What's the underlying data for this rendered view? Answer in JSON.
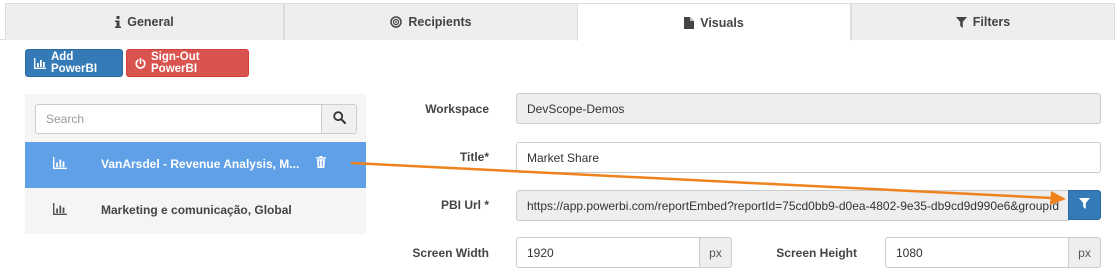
{
  "tabs": [
    {
      "label": "General",
      "icon": "info-icon"
    },
    {
      "label": "Recipients",
      "icon": "target-icon"
    },
    {
      "label": "Visuals",
      "icon": "file-icon"
    },
    {
      "label": "Filters",
      "icon": "funnel-icon"
    }
  ],
  "active_tab": "Visuals",
  "toolbar": {
    "add_powerbi_label": "Add PowerBI",
    "signout_powerbi_label": "Sign-Out PowerBI"
  },
  "search": {
    "placeholder": "Search"
  },
  "visuals_list": [
    {
      "label": "VanArsdel - Revenue Analysis, M...",
      "selected": true
    },
    {
      "label": "Marketing e comunicação, Global",
      "selected": false
    }
  ],
  "form": {
    "workspace_label": "Workspace",
    "workspace_value": "DevScope-Demos",
    "title_label": "Title*",
    "title_value": "Market Share",
    "pbi_url_label": "PBI Url *",
    "pbi_url_value": "https://app.powerbi.com/reportEmbed?reportId=75cd0bb9-d0ea-4802-9e35-db9cd9d990e6&groupId",
    "screen_width_label": "Screen Width",
    "screen_width_value": "1920",
    "screen_width_unit": "px",
    "screen_height_label": "Screen Height",
    "screen_height_value": "1080",
    "screen_height_unit": "px"
  },
  "colors": {
    "primary": "#337ab7",
    "danger": "#d9534f",
    "selected_row": "#5fa0e6",
    "annotation_arrow": "#f0821e"
  }
}
